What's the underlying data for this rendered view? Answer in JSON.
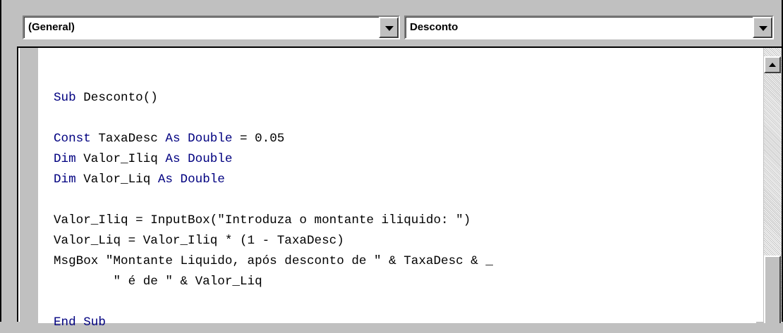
{
  "toolbar": {
    "object_combo": {
      "value": "(General)"
    },
    "procedure_combo": {
      "value": "Desconto"
    }
  },
  "editor": {
    "lines": [
      [],
      [
        [
          "kw",
          "Sub"
        ],
        [
          "",
          " Desconto()"
        ]
      ],
      [],
      [
        [
          "kw",
          "Const"
        ],
        [
          "",
          " TaxaDesc "
        ],
        [
          "kw",
          "As"
        ],
        [
          "",
          " "
        ],
        [
          "kw",
          "Double"
        ],
        [
          "",
          " = 0.05"
        ]
      ],
      [
        [
          "kw",
          "Dim"
        ],
        [
          "",
          " Valor_Iliq "
        ],
        [
          "kw",
          "As"
        ],
        [
          "",
          " "
        ],
        [
          "kw",
          "Double"
        ]
      ],
      [
        [
          "kw",
          "Dim"
        ],
        [
          "",
          " Valor_Liq "
        ],
        [
          "kw",
          "As"
        ],
        [
          "",
          " "
        ],
        [
          "kw",
          "Double"
        ]
      ],
      [],
      [
        [
          "",
          "Valor_Iliq = InputBox(\"Introduza o montante iliquido: \")"
        ]
      ],
      [
        [
          "",
          "Valor_Liq = Valor_Iliq * (1 - TaxaDesc)"
        ]
      ],
      [
        [
          "",
          "MsgBox \"Montante Liquido, após desconto de \" & TaxaDesc & _"
        ]
      ],
      [
        [
          "",
          "        \" é de \" & Valor_Liq"
        ]
      ],
      [],
      [
        [
          "kw",
          "End"
        ],
        [
          "",
          " "
        ],
        [
          "kw",
          "Sub"
        ]
      ]
    ]
  },
  "colors": {
    "keyword": "#000080",
    "text": "#000000",
    "chrome": "#c0c0c0"
  },
  "icons": {
    "object_dropdown": "chevron-down-icon",
    "procedure_dropdown": "chevron-down-icon",
    "scroll_up": "arrow-up-icon"
  }
}
